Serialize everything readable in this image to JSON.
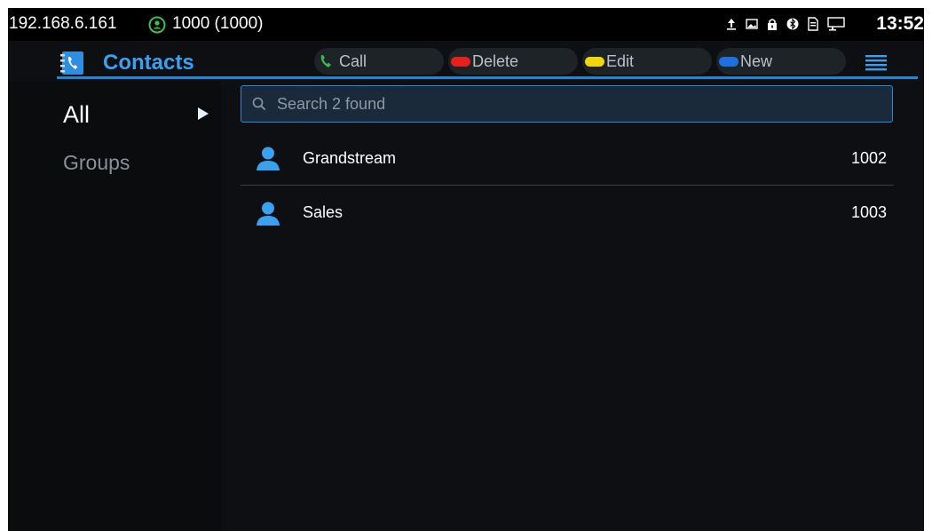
{
  "status_bar": {
    "ip": "192.168.6.161",
    "account": "1000 (1000)",
    "time": "13:52",
    "icons": [
      "upload-icon",
      "picture-icon",
      "lock-icon",
      "bluetooth-icon",
      "sd-card-icon",
      "network-icon"
    ]
  },
  "header": {
    "title": "Contacts",
    "actions": {
      "call": "Call",
      "delete": "Delete",
      "edit": "Edit",
      "new": "New"
    },
    "colors": {
      "accent": "#3aa0f0",
      "call": "#3fb34f",
      "delete": "#e8201c",
      "edit": "#f2d60c",
      "new": "#1e6fe0"
    }
  },
  "nav": {
    "all": "All",
    "groups": "Groups"
  },
  "search": {
    "placeholder": "Search 2 found"
  },
  "contacts": [
    {
      "name": "Grandstream",
      "number": "1002"
    },
    {
      "name": "Sales",
      "number": "1003"
    }
  ]
}
